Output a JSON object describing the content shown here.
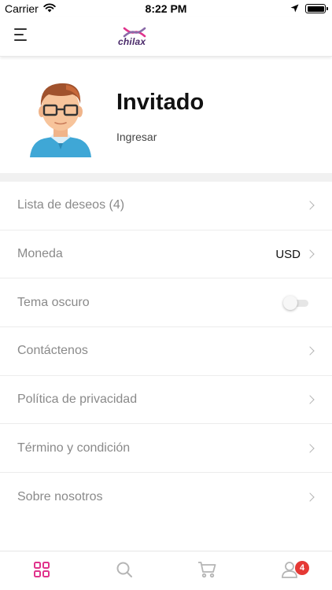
{
  "status_bar": {
    "carrier": "Carrier",
    "time": "8:22 PM"
  },
  "header": {
    "logo_text": "chilax",
    "menu_icon": "hamburger-menu-icon"
  },
  "profile": {
    "name": "Invitado",
    "login_label": "Ingresar"
  },
  "settings": {
    "wishlist": "Lista de deseos (4)",
    "currency": "Moneda",
    "currency_value": "USD",
    "dark_theme": "Tema oscuro",
    "dark_theme_enabled": false,
    "contact": "Contáctenos",
    "privacy": "Política de privacidad",
    "terms": "Término y condición",
    "about": "Sobre nosotros"
  },
  "tab_bar": {
    "active_color": "#e0338c",
    "inactive_color": "#b5b5b5",
    "tabs": [
      "grid-icon",
      "search-icon",
      "cart-icon",
      "profile-icon"
    ],
    "profile_badge": "4"
  }
}
